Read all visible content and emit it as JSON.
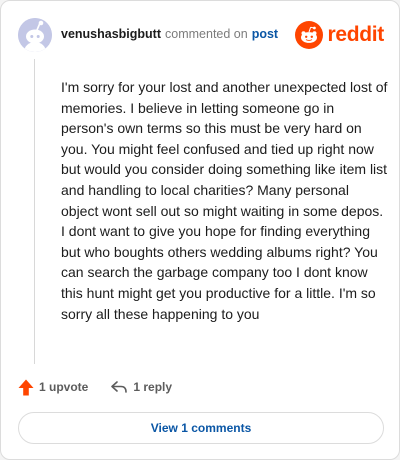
{
  "comment": {
    "username": "venushasbigbutt",
    "commented_text": "commented on",
    "post_link": "post",
    "body": "I'm sorry for your lost and another unexpected lost of memories. I believe in letting someone go in person's own terms so this must be very hard on you. You might feel confused and tied up right now but would you consider doing something like item list and handling to local charities? Many personal object wont sell out so might waiting in some depos. I dont want to give you hope for finding everything but who boughts others wedding albums right? You can search the garbage company too I dont know this hunt might get you productive for a little. I'm so sorry all these happening to you"
  },
  "brand": {
    "name": "reddit",
    "color": "#ff4500"
  },
  "actions": {
    "upvote_label": "1 upvote",
    "reply_label": "1 reply"
  },
  "footer": {
    "view_comments_label": "View 1 comments"
  },
  "icons": {
    "avatar": "snoo-avatar-icon",
    "logo": "reddit-snoo-icon",
    "upvote": "upvote-arrow-icon",
    "reply": "reply-arrow-icon"
  },
  "colors": {
    "accent": "#ff4500",
    "link": "#0a56a5",
    "avatar_bg": "#c3c7e6"
  }
}
